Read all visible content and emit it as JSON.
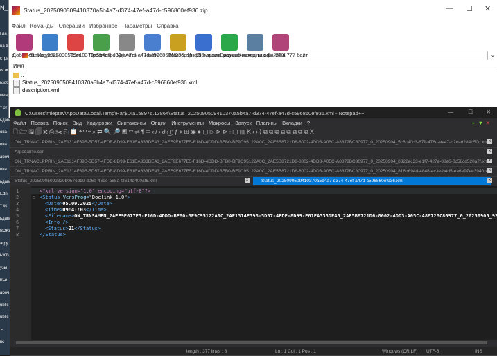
{
  "desktop": {
    "top_label": "N_",
    "items": [
      "Гла",
      "на во до",
      "стри",
      "ВОКУ",
      "ьзоб",
      "менн",
      "т от",
      "ьдаги",
      "ова",
      "ова",
      "абоч",
      "ова",
      "ьдаги",
      "Edn",
      "т кс",
      "ьдаги",
      "ВОКУ",
      "агру",
      "ьзоб",
      "узы",
      "бъе",
      "абоч",
      "ublic",
      "ublic",
      "ъ",
      "вс"
    ]
  },
  "rar": {
    "title": "Status_2025090509410370a5b4a7-d374-47ef-a47d-c596860ef936.zip",
    "menu": [
      "Файл",
      "Команды",
      "Операции",
      "Избранное",
      "Параметры",
      "Справка"
    ],
    "toolbar": [
      {
        "label": "Добавить",
        "color": "#b03a7a"
      },
      {
        "label": "Извлечь...",
        "color": "#3c7fc8"
      },
      {
        "label": "Тест",
        "color": "#d44"
      },
      {
        "label": "Просмотр",
        "color": "#4aa04a"
      },
      {
        "label": "Удалить",
        "color": "#888"
      },
      {
        "label": "Найти",
        "color": "#4a7fd0"
      },
      {
        "label": "Мастер",
        "color": "#c9a020"
      },
      {
        "label": "Информация",
        "color": "#3a6fd0"
      },
      {
        "label": "Вирусы",
        "color": "#2aa84a"
      },
      {
        "label": "Комментарий",
        "color": "#5a7fa0"
      },
      {
        "label": "SFX",
        "color": "#b0457a"
      }
    ],
    "address": "Status_2025090509410370a5b4a7-d374-47ef-a47d-c596860ef936.zip - ZIP архив, размер исходных файлов 777 байт",
    "column_name": "Имя",
    "files": [
      "..",
      "Status_2025090509410370a5b4a7-d374-47ef-a47d-c596860ef936.xml",
      "description.xml"
    ]
  },
  "npp": {
    "title": "C:\\Users\\mleptev\\AppData\\Local\\Temp\\Rar$DIa158976.13864\\Status_2025090509410370a5b4a7-d374-47ef-a47d-c596860ef936.xml - Notepad++",
    "menu": [
      "Файл",
      "Правка",
      "Поиск",
      "Вид",
      "Кодировки",
      "Синтаксисы",
      "Опции",
      "Инструменты",
      "Макросы",
      "Запуск",
      "Плагины",
      "Вкладки",
      "?"
    ],
    "tabs_row1": "ON_TRNACLPPRIN_2AE1314F39B-5D57-4FDE-8D99-E61EA333DE43_2AEF9E677E5-F16D-4DDD-BFB0-BF9C95122A0C_2AE5B8721D6-8002-4DD3-A05C-A8872BC80977_0_20250904_5c6c40c3-67ff-476d-ae47-b2ead284b50c.xml",
    "tabs_row2": "Агровапто.сег",
    "tabs_row3": "ON_TRNACLPPRIN_2AE1314F39B-5D57-4FDE-8D99-E61EA333DE43_2AEF9E677E5-F16D-4DDD-BFB0-BF9C95122A0C_2AE5B8721D6-8002-4DD3-A05C-A8872BC80977_0_20250904_0322ec33-e1f7-427a-88a6-0c58cd520a7f.xml",
    "tabs_row4": "ON_TRNACLPPRIN_2AE1314F39B-5D57-4FDE-8D99-E61EA333DE43_2AEF9E677E5-F16D-4DDD-BFB0-BF9C95122A0C_2AE5B8721D6-8002-4DD3-A05C-A8872BC80977_0_20250904_818b694d-4848-4c3e-b4d5-ea6e97ee3940.xml",
    "tab_left": "Status_20250905092320b057cd10-d06a-469e-a85a-f3614d400af6.xml",
    "tab_active": "Status_2025090509410370a5b4a7-d374-47ef-a47d-c596860ef936.xml",
    "code": {
      "line1": "<?xml version=\"1.0\" encoding=\"utf-8\"?>",
      "line2_open": "<Status",
      "line2_attr": "VersProg=",
      "line2_val": "\"Doclink 1.0\"",
      "line2_close": ">",
      "date_open": "<Date>",
      "date": "05.09.2025",
      "date_close": "</Date>",
      "time_open": "<Time>",
      "time": "09:41:03",
      "time_close": "</Time>",
      "filename_open": "<Filename>",
      "filename": "ON_TRNSAMEN_2AEF9E677E5-F16D-4DDD-BFB0-BF9C95122A0C_2AE1314F39B-5D57-4FDE-8D99-E61EA333DE43_2AE5B8721D6-8002-4DD3-A05C-A8872BC80977_0_20250905_929c9c",
      "info": "<Info />",
      "status_open": "<Status>",
      "status": "21",
      "status_close": "</Status>",
      "end": "</Status>"
    },
    "statusbar": {
      "length": "length : 377    lines : 8",
      "pos": "Ln : 1    Col : 1    Pos : 1",
      "eol": "Windows (CR LF)",
      "enc": "UTF-8",
      "ins": "INS"
    }
  }
}
